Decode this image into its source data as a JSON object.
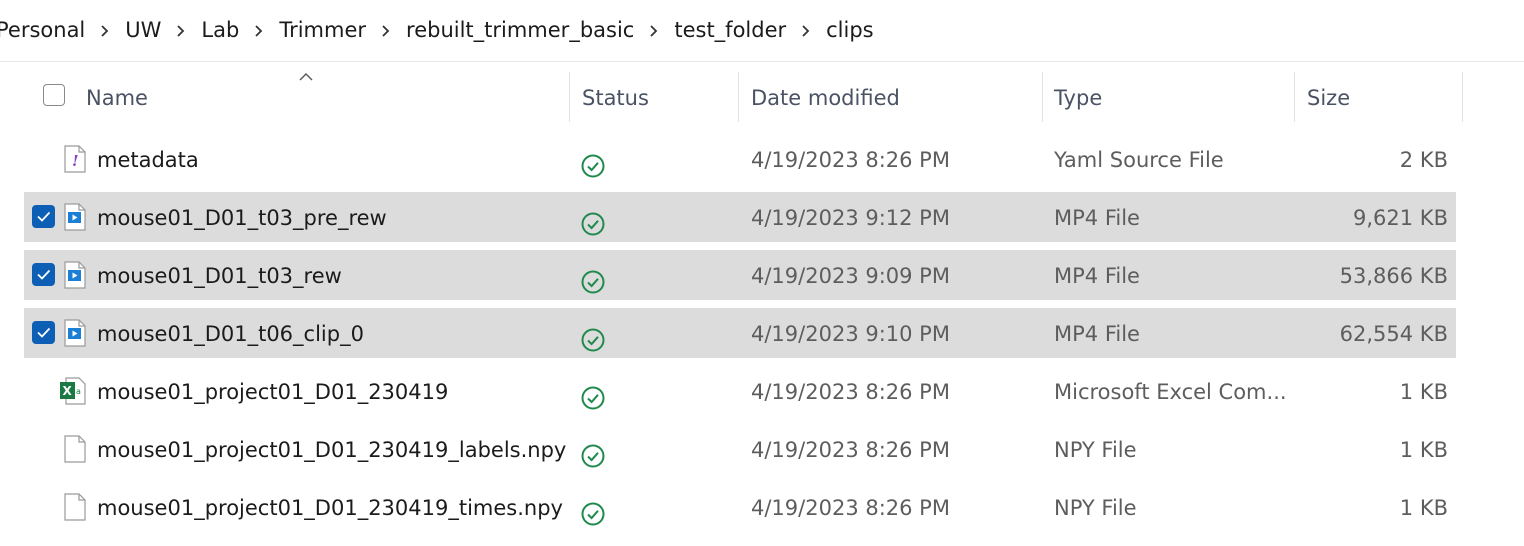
{
  "breadcrumb": [
    {
      "label": "Personal"
    },
    {
      "label": "UW"
    },
    {
      "label": "Lab"
    },
    {
      "label": "Trimmer"
    },
    {
      "label": "rebuilt_trimmer_basic"
    },
    {
      "label": "test_folder"
    },
    {
      "label": "clips"
    }
  ],
  "columns": {
    "name": "Name",
    "status": "Status",
    "date": "Date modified",
    "type": "Type",
    "size": "Size"
  },
  "rows": [
    {
      "name": "metadata",
      "date": "4/19/2023 8:26 PM",
      "type": "Yaml Source File",
      "size": "2 KB",
      "icon": "yaml-file-icon",
      "selected": false,
      "status": "synced-icon"
    },
    {
      "name": "mouse01_D01_t03_pre_rew",
      "date": "4/19/2023 9:12 PM",
      "type": "MP4 File",
      "size": "9,621 KB",
      "icon": "video-file-icon",
      "selected": true,
      "status": "synced-icon"
    },
    {
      "name": "mouse01_D01_t03_rew",
      "date": "4/19/2023 9:09 PM",
      "type": "MP4 File",
      "size": "53,866 KB",
      "icon": "video-file-icon",
      "selected": true,
      "status": "synced-icon"
    },
    {
      "name": "mouse01_D01_t06_clip_0",
      "date": "4/19/2023 9:10 PM",
      "type": "MP4 File",
      "size": "62,554 KB",
      "icon": "video-file-icon",
      "selected": true,
      "status": "synced-icon"
    },
    {
      "name": "mouse01_project01_D01_230419",
      "date": "4/19/2023 8:26 PM",
      "type": "Microsoft Excel Com...",
      "size": "1 KB",
      "icon": "excel-file-icon",
      "selected": false,
      "status": "synced-icon"
    },
    {
      "name": "mouse01_project01_D01_230419_labels.npy",
      "date": "4/19/2023 8:26 PM",
      "type": "NPY File",
      "size": "1 KB",
      "icon": "blank-file-icon",
      "selected": false,
      "status": "synced-icon"
    },
    {
      "name": "mouse01_project01_D01_230419_times.npy",
      "date": "4/19/2023 8:26 PM",
      "type": "NPY File",
      "size": "1 KB",
      "icon": "blank-file-icon",
      "selected": false,
      "status": "synced-icon"
    }
  ],
  "colors": {
    "selection": "#dcdcdc",
    "checkbox": "#0c5fb4",
    "status_green": "#1f8a4c"
  }
}
